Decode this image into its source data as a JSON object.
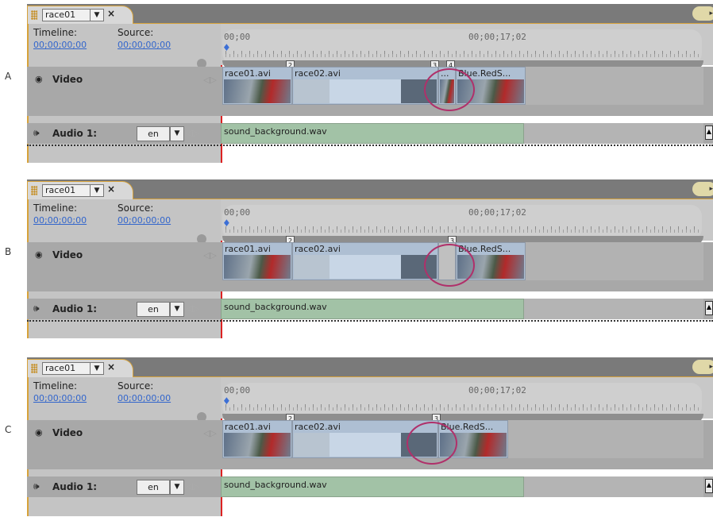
{
  "panels": [
    {
      "label": "A",
      "tab": {
        "name": "race01",
        "dropdown": "▼",
        "close": "×",
        "menu": "▸"
      },
      "timeline_label": "Timeline:",
      "source_label": "Source:",
      "timeline_time": "00;00;00;00",
      "source_time": "00;00;00;00",
      "ruler": {
        "start": "00;00",
        "mid": "00;00;17;02",
        "markers": [
          "2",
          "3",
          "4"
        ]
      },
      "video_track": "Video",
      "clips": [
        {
          "label": "race01.avi"
        },
        {
          "label": "race02.avi"
        },
        {
          "label": "..."
        },
        {
          "label": "Blue.RedS..."
        }
      ],
      "audio_track": "Audio 1:",
      "language": "en",
      "audio_clip": "sound_background.wav"
    },
    {
      "label": "B",
      "tab": {
        "name": "race01",
        "dropdown": "▼",
        "close": "×",
        "menu": "▸"
      },
      "timeline_label": "Timeline:",
      "source_label": "Source:",
      "timeline_time": "00;00;00;00",
      "source_time": "00;00;00;00",
      "ruler": {
        "start": "00;00",
        "mid": "00;00;17;02",
        "markers": [
          "2",
          "3"
        ]
      },
      "video_track": "Video",
      "clips": [
        {
          "label": "race01.avi"
        },
        {
          "label": "race02.avi"
        },
        {
          "label": ""
        },
        {
          "label": "Blue.RedS..."
        }
      ],
      "audio_track": "Audio 1:",
      "language": "en",
      "audio_clip": "sound_background.wav"
    },
    {
      "label": "C",
      "tab": {
        "name": "race01",
        "dropdown": "▼",
        "close": "×",
        "menu": "▸"
      },
      "timeline_label": "Timeline:",
      "source_label": "Source:",
      "timeline_time": "00;00;00;00",
      "source_time": "00;00;00;00",
      "ruler": {
        "start": "00;00",
        "mid": "00;00;17;02",
        "markers": [
          "2",
          "3"
        ]
      },
      "video_track": "Video",
      "clips": [
        {
          "label": "race01.avi"
        },
        {
          "label": "race02.avi"
        },
        {
          "label": "Blue.RedS..."
        }
      ],
      "audio_track": "Audio 1:",
      "language": "en",
      "audio_clip": "sound_background.wav"
    }
  ]
}
